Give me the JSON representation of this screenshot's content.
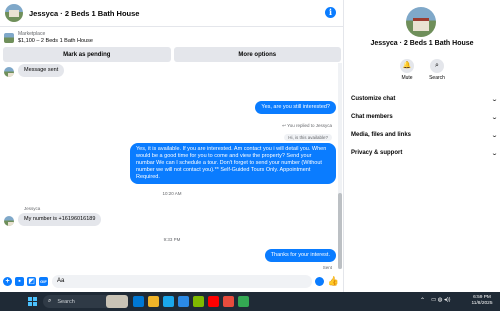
{
  "chat": {
    "title": "Jessyca · 2 Beds 1 Bath House",
    "listing": {
      "source": "Marketplace",
      "title": "$1,100 – 2 Beds 1 Bath House"
    },
    "actions": {
      "mark_pending": "Mark as pending",
      "more_options": "More options"
    },
    "messages": {
      "first_received": "Message sent",
      "out_1": "Yes, are you still interested?",
      "reply_meta": "You replied to Jessyca",
      "quoted": "Hi, is this available?",
      "out_2": "Yes, it is available. If you are interested.  Am contact you i will detail you.  When would be a good time for you to come and view the property? Send your numbar We can I schedule a tour.  Don't forget to send your number (Without number we will not contact you).** Self-Guided Tours Only. Appointment Required.",
      "time_1": "10:20 AM",
      "sender_name": "Jessyca",
      "in_number": "My number is +16196016189",
      "time_2": "9:33 PM",
      "out_3": "Thanks for your interest.",
      "status": "Sent"
    },
    "composer": {
      "value": "Aa"
    }
  },
  "details": {
    "name": "Jessyca · 2 Beds 1 Bath House",
    "quick_actions": [
      {
        "label": "Mute",
        "icon": "bell-icon"
      },
      {
        "label": "Search",
        "icon": "search-icon"
      }
    ],
    "sections": [
      "Customize chat",
      "Chat members",
      "Media, files and links",
      "Privacy & support"
    ]
  },
  "taskbar": {
    "search_label": "Search",
    "time": "6:59 PM",
    "date": "11/8/2025",
    "app_colors": [
      "#0078d4",
      "#f0b429",
      "#1aa7ec",
      "#2b8ae6",
      "#7fba00",
      "#ff0000",
      "#e84c3d",
      "#34a853"
    ]
  },
  "colors": {
    "accent": "#0a7cff",
    "bubble_in": "#e4e6eb",
    "taskbar": "#1f2a36"
  }
}
